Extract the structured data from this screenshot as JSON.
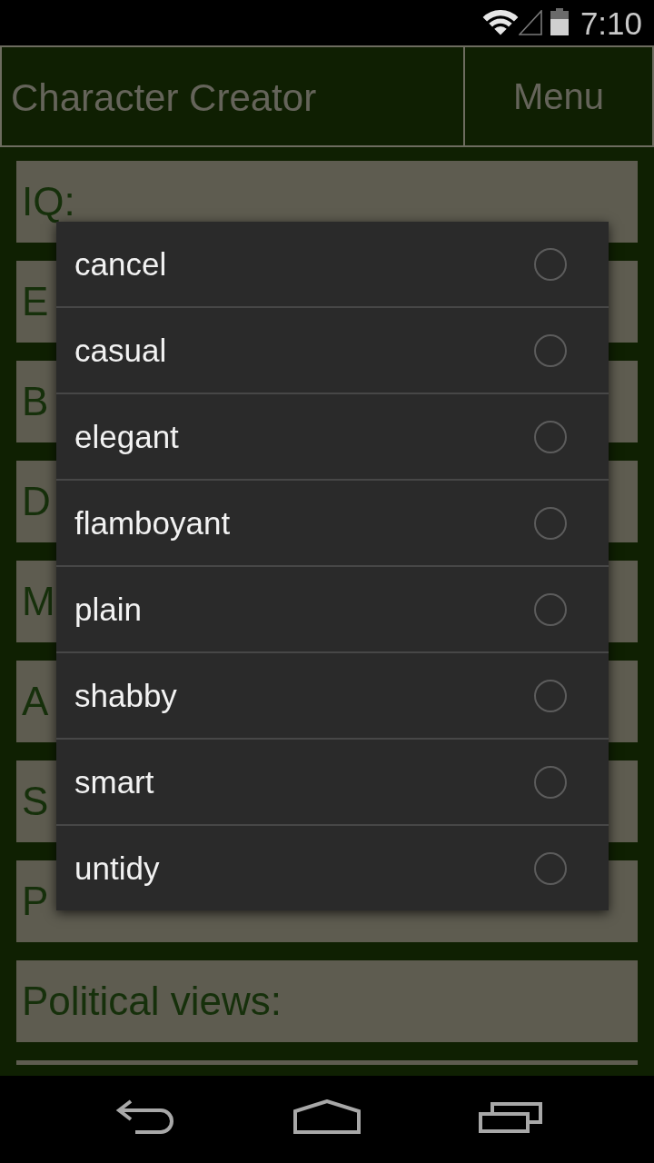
{
  "status_bar": {
    "time": "7:10"
  },
  "header": {
    "title": "Character Creator",
    "menu_button": "Menu"
  },
  "attribute_buttons": [
    {
      "label": "IQ:"
    },
    {
      "label": "E"
    },
    {
      "label": "B"
    },
    {
      "label": "D"
    },
    {
      "label": "M"
    },
    {
      "label": "A"
    },
    {
      "label": "S"
    },
    {
      "label": "P"
    },
    {
      "label": "Political views:"
    }
  ],
  "next_field_peek": true,
  "dialog": {
    "options": [
      {
        "label": "cancel",
        "selected": false
      },
      {
        "label": "casual",
        "selected": false
      },
      {
        "label": "elegant",
        "selected": false
      },
      {
        "label": "flamboyant",
        "selected": false
      },
      {
        "label": "plain",
        "selected": false
      },
      {
        "label": "shabby",
        "selected": false
      },
      {
        "label": "smart",
        "selected": false
      },
      {
        "label": "untidy",
        "selected": false
      }
    ]
  }
}
